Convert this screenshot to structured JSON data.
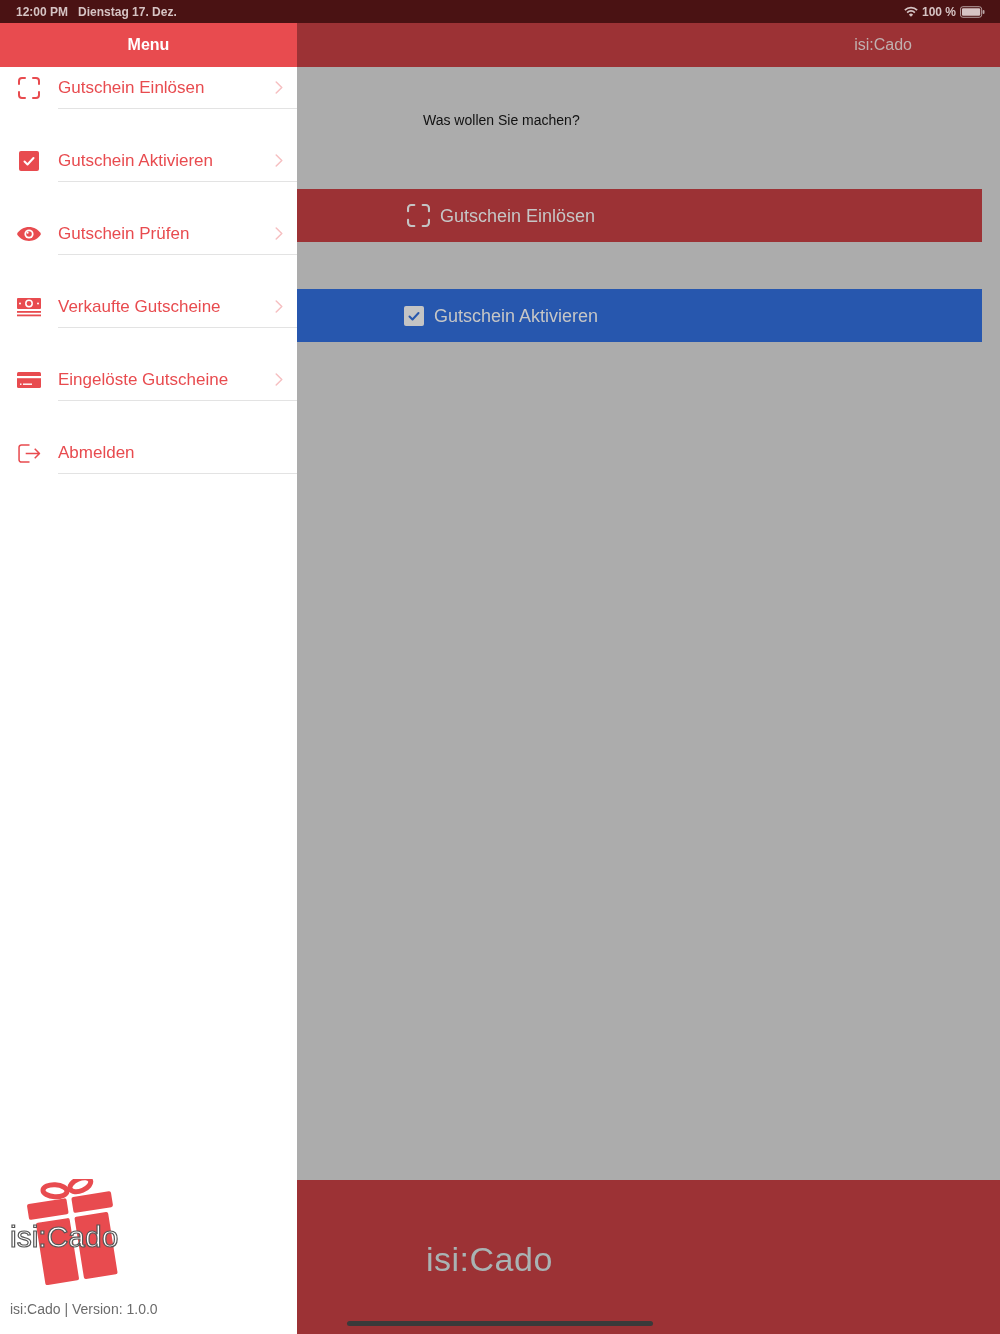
{
  "status_bar": {
    "time": "12:00 PM",
    "date": "Dienstag 17. Dez.",
    "battery": "100 %"
  },
  "sidebar": {
    "title": "Menu",
    "items": [
      {
        "label": "Gutschein Einlösen",
        "kind": "scan",
        "chevron": true
      },
      {
        "label": "Gutschein Aktivieren",
        "kind": "check",
        "chevron": true
      },
      {
        "label": "Gutschein Prüfen",
        "kind": "eye",
        "chevron": true
      },
      {
        "label": "Verkaufte Gutscheine",
        "kind": "cash",
        "chevron": true
      },
      {
        "label": "Eingelöste Gutscheine",
        "kind": "card",
        "chevron": true
      },
      {
        "label": "Abmelden",
        "kind": "exit",
        "chevron": false
      }
    ],
    "logo": {
      "text": "isi:Cado"
    },
    "version": "isi:Cado | Version: 1.0.0"
  },
  "nav_bar": {
    "title": "isi:Cado"
  },
  "content": {
    "prompt": "Was wollen Sie machen?",
    "buttons": [
      {
        "label": "Gutschein Einlösen",
        "kind": "scan",
        "color": "#9c3235"
      },
      {
        "label": "Gutschein Aktivieren",
        "kind": "check",
        "color": "#2757ae"
      }
    ]
  },
  "footer": {
    "brand": "isi:Cado"
  }
}
